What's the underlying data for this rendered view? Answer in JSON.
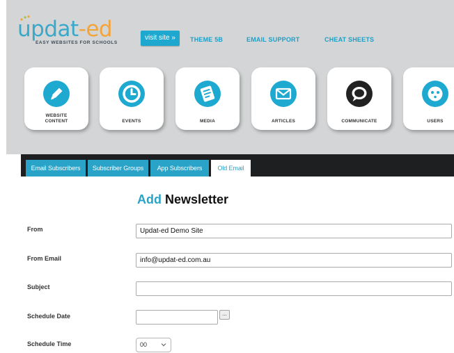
{
  "logo": {
    "name_main": "updat",
    "name_accent": "-ed",
    "tagline": "EASY WEBSITES FOR SCHOOLS"
  },
  "topnav": {
    "visit_label": "visit site »",
    "links": [
      "THEME 5B",
      "EMAIL SUPPORT",
      "CHEAT SHEETS"
    ]
  },
  "modules": [
    {
      "label_line1": "WEBSITE",
      "label_line2": "CONTENT",
      "icon": "pencil-icon"
    },
    {
      "label_line1": "EVENTS",
      "icon": "clock-icon"
    },
    {
      "label_line1": "MEDIA",
      "icon": "document-icon"
    },
    {
      "label_line1": "ARTICLES",
      "icon": "envelope-icon"
    },
    {
      "label_line1": "COMMUNICATE",
      "icon": "speech-bubble-icon"
    },
    {
      "label_line1": "USERS",
      "icon": "user-face-icon"
    }
  ],
  "tabs": [
    "Email Subscribers",
    "Subscriber Groups",
    "App Subscribers",
    "Old Email"
  ],
  "active_tab": "Old Email",
  "form": {
    "title_accent": "Add",
    "title_rest": "Newsletter",
    "fields": [
      {
        "label": "From",
        "value": "Updat-ed Demo Site"
      },
      {
        "label": "From Email",
        "value": "info@updat-ed.com.au"
      },
      {
        "label": "Subject",
        "value": ""
      },
      {
        "label": "Schedule Date",
        "value": "",
        "button_label": "..."
      },
      {
        "label": "Schedule Time",
        "value": "00"
      }
    ]
  },
  "colors": {
    "accent": "#1ea9d1",
    "header_bg": "#d3d5d6",
    "tabbar_bg": "#1e1f20",
    "logo_orange": "#f3a43a"
  }
}
